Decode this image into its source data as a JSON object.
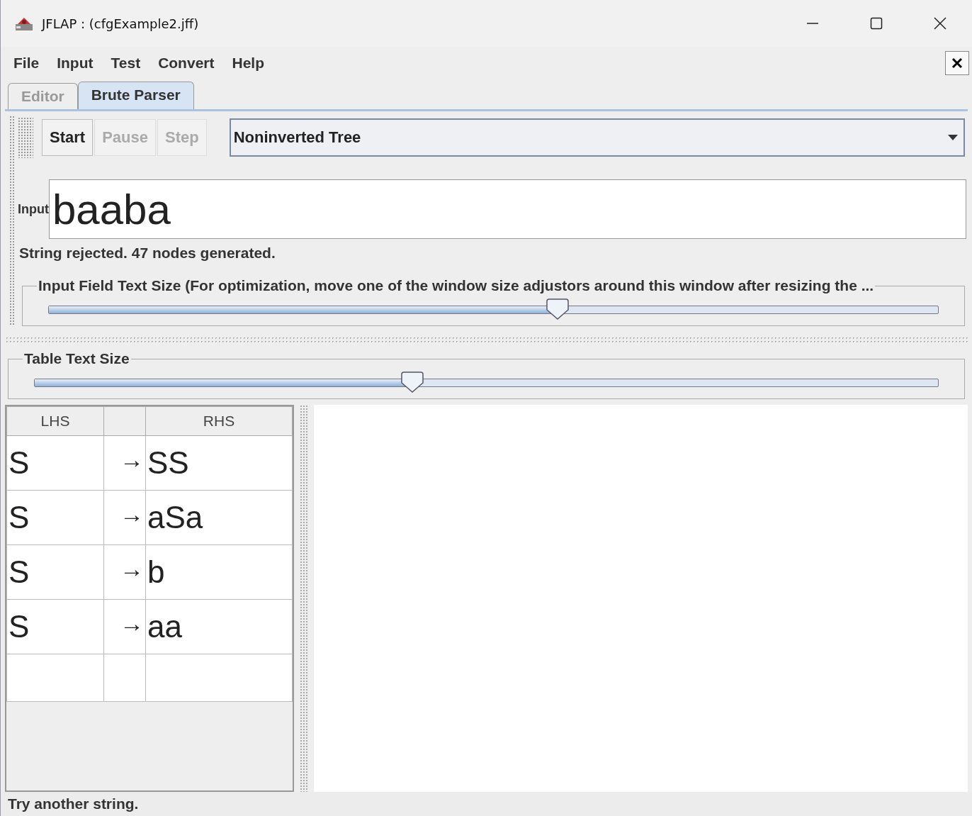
{
  "window": {
    "title": "JFLAP : (cfgExample2.jff)"
  },
  "menu": [
    "File",
    "Input",
    "Test",
    "Convert",
    "Help"
  ],
  "tabs": [
    {
      "label": "Editor",
      "selected": false
    },
    {
      "label": "Brute Parser",
      "selected": true
    }
  ],
  "toolbar": {
    "buttons": [
      {
        "label": "Start",
        "disabled": false
      },
      {
        "label": "Pause",
        "disabled": true
      },
      {
        "label": "Step",
        "disabled": true
      }
    ],
    "view_select": "Noninverted Tree"
  },
  "input": {
    "label": "Input",
    "value": "baaba"
  },
  "result": "String rejected.  47 nodes generated.",
  "input_size_slider": {
    "title": "Input Field Text Size (For optimization, move one of the window size adjustors around this window after resizing the ...",
    "level": 0.57
  },
  "table_size_slider": {
    "title": "Table Text Size",
    "level": 0.42
  },
  "table": {
    "columns": [
      "LHS",
      "",
      "RHS"
    ],
    "rows": [
      [
        "S",
        "→",
        "SS"
      ],
      [
        "S",
        "→",
        "aSa"
      ],
      [
        "S",
        "→",
        "b"
      ],
      [
        "S",
        "→",
        "aa"
      ]
    ]
  },
  "status_bar": "Try another string."
}
